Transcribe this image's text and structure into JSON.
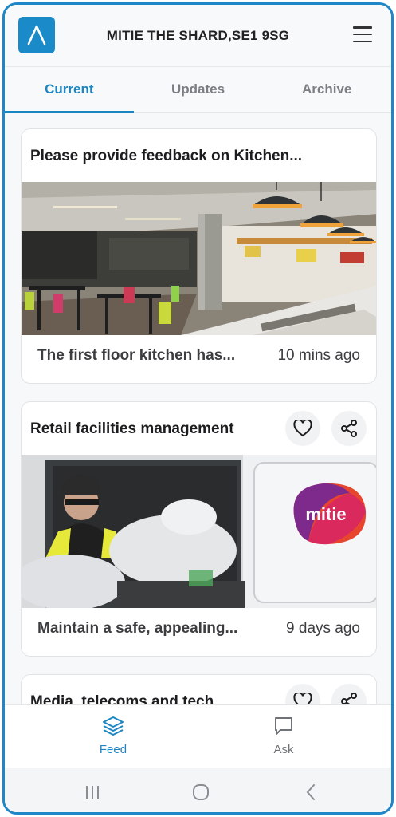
{
  "header": {
    "title": "MITIE THE SHARD,SE1 9SG"
  },
  "tabs": [
    {
      "label": "Current",
      "active": true
    },
    {
      "label": "Updates",
      "active": false
    },
    {
      "label": "Archive",
      "active": false
    }
  ],
  "feed": [
    {
      "title": "Please provide feedback on Kitchen...",
      "summary": "The first floor kitchen has...",
      "time": "10 mins ago",
      "image": "kitchen-photo"
    },
    {
      "title": "Retail facilities management",
      "summary": "Maintain a safe, appealing...",
      "time": "9 days ago",
      "image": "waste-collection-photo",
      "van_logo": "mitie"
    },
    {
      "title": "Media, telecoms and tech"
    }
  ],
  "bottom_nav": [
    {
      "label": "Feed",
      "icon": "layers-icon",
      "active": true
    },
    {
      "label": "Ask",
      "icon": "chat-icon",
      "active": false
    }
  ],
  "colors": {
    "accent": "#1b86c3",
    "inactive": "#7b7f84"
  }
}
